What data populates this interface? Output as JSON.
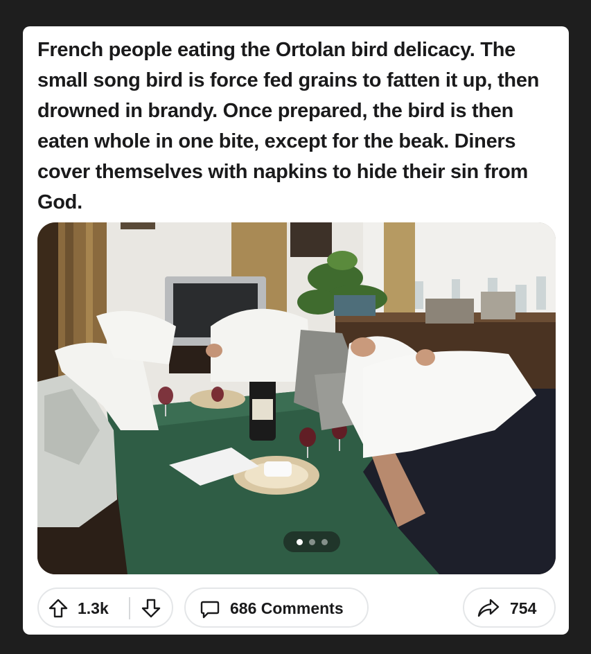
{
  "post": {
    "title": "French people eating the Ortolan bird delicacy. The small song bird is force fed grains to fatten it up, then drowned in brandy. Once prepared, the bird is then eaten whole in one bite, except for the beak. Diners cover themselves with napkins to hide their sin from God."
  },
  "media": {
    "carousel_total": 3,
    "carousel_active": 1
  },
  "actions": {
    "score": "1.3k",
    "comments_label": "686 Comments",
    "shares": "754"
  },
  "icons": {
    "upvote": "arrow-up-outline-icon",
    "downvote": "arrow-down-outline-icon",
    "comment": "speech-bubble-icon",
    "share": "share-arrow-icon"
  },
  "colors": {
    "background": "#1e1e1e",
    "card": "#ffffff",
    "text": "#1a1a1b",
    "pill_border": "#e4e6e8"
  }
}
